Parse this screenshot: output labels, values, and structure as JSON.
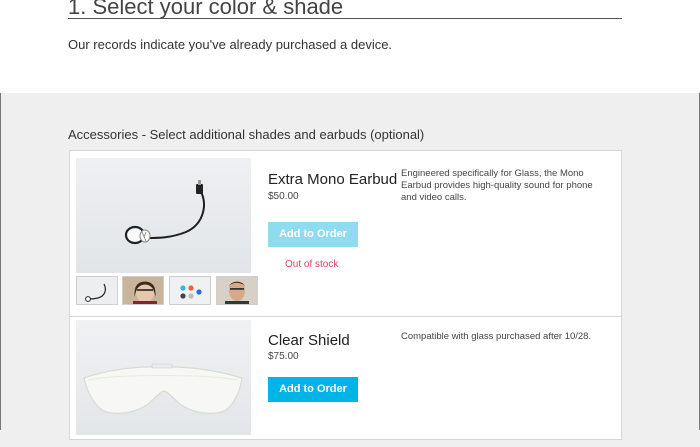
{
  "header": {
    "section_title": "1. Select your color & shade",
    "records_note": "Our records indicate you've already purchased a device."
  },
  "accessories": {
    "heading": "Accessories - Select additional shades and earbuds (optional)",
    "items": [
      {
        "name": "Extra Mono Earbud",
        "price": "$50.00",
        "button_label": "Add to Order",
        "stock_status": "Out of stock",
        "description": "Engineered specifically for Glass, the Mono Earbud provides high-quality sound for phone and video calls.",
        "button_color": "#8fdcf0",
        "thumbnails": [
          "earbud-thumbnail",
          "person-wearing-glass-thumbnail",
          "color-options-thumbnail",
          "man-wearing-earbud-thumbnail"
        ]
      },
      {
        "name": "Clear Shield",
        "price": "$75.00",
        "button_label": "Add to Order",
        "description": "Compatible with glass purchased after 10/28.",
        "button_color": "#00b4e6"
      }
    ]
  },
  "colors": {
    "accent": "#00b4e6",
    "accent_disabled": "#8fdcf0",
    "out_of_stock": "#d9436a"
  }
}
